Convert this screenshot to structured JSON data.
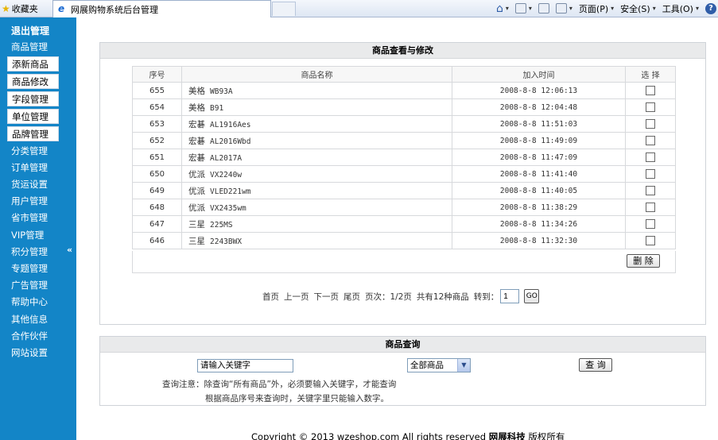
{
  "browser": {
    "favorites_label": "收藏夹",
    "tab_title": "网展购物系统后台管理",
    "page_menu": "页面(P)",
    "safety_menu": "安全(S)",
    "tools_menu": "工具(O)"
  },
  "sidebar": {
    "header": "退出管理",
    "items": [
      {
        "label": "商品管理"
      },
      {
        "label": "添新商品"
      },
      {
        "label": "商品修改"
      },
      {
        "label": "字段管理"
      },
      {
        "label": "单位管理"
      },
      {
        "label": "品牌管理"
      },
      {
        "label": "分类管理"
      },
      {
        "label": "订单管理"
      },
      {
        "label": "货运设置"
      },
      {
        "label": "用户管理"
      },
      {
        "label": "省市管理"
      },
      {
        "label": "VIP管理"
      },
      {
        "label": "积分管理"
      },
      {
        "label": "专题管理"
      },
      {
        "label": "广告管理"
      },
      {
        "label": "帮助中心"
      },
      {
        "label": "其他信息"
      },
      {
        "label": "合作伙伴"
      },
      {
        "label": "网站设置"
      }
    ],
    "collapse_glyph": "«"
  },
  "product_panel": {
    "title": "商品查看与修改",
    "columns": [
      "序号",
      "商品名称",
      "加入时间",
      "选 择"
    ],
    "rows": [
      {
        "id": "655",
        "brand": "美格",
        "model": "WB93A",
        "time": "2008-8-8 12:06:13"
      },
      {
        "id": "654",
        "brand": "美格",
        "model": "B91",
        "time": "2008-8-8 12:04:48"
      },
      {
        "id": "653",
        "brand": "宏碁",
        "model": "AL1916Aes",
        "time": "2008-8-8 11:51:03"
      },
      {
        "id": "652",
        "brand": "宏碁",
        "model": "AL2016Wbd",
        "time": "2008-8-8 11:49:09"
      },
      {
        "id": "651",
        "brand": "宏碁",
        "model": "AL2017A",
        "time": "2008-8-8 11:47:09"
      },
      {
        "id": "650",
        "brand": "优派",
        "model": "VX2240w",
        "time": "2008-8-8 11:41:40"
      },
      {
        "id": "649",
        "brand": "优派",
        "model": "VLED221wm",
        "time": "2008-8-8 11:40:05"
      },
      {
        "id": "648",
        "brand": "优派",
        "model": "VX2435wm",
        "time": "2008-8-8 11:38:29"
      },
      {
        "id": "647",
        "brand": "三星",
        "model": "225MS",
        "time": "2008-8-8 11:34:26"
      },
      {
        "id": "646",
        "brand": "三星",
        "model": "2243BWX",
        "time": "2008-8-8 11:32:30"
      }
    ],
    "delete_label": "删 除"
  },
  "pager": {
    "first": "首页",
    "prev": "上一页",
    "next": "下一页",
    "last": "尾页",
    "page_info": "页次：1/2页",
    "total": "共有12种商品",
    "goto_label": "转到：",
    "page_value": "1",
    "go_label": "GO"
  },
  "search_panel": {
    "title": "商品查询",
    "keyword_value": "请输入关键字",
    "scope_selected": "全部商品",
    "query_label": "查 询",
    "note_line1": "查询注意：除查询“所有商品”外，必须要输入关键字，才能查询",
    "note_line2": "根据商品序号来查询时，关键字里只能输入数字。"
  },
  "footer": {
    "copyright": "Copyright © 2013 wzeshop.com All rights reserved",
    "company": "网展科技",
    "rights": "版权所有"
  }
}
